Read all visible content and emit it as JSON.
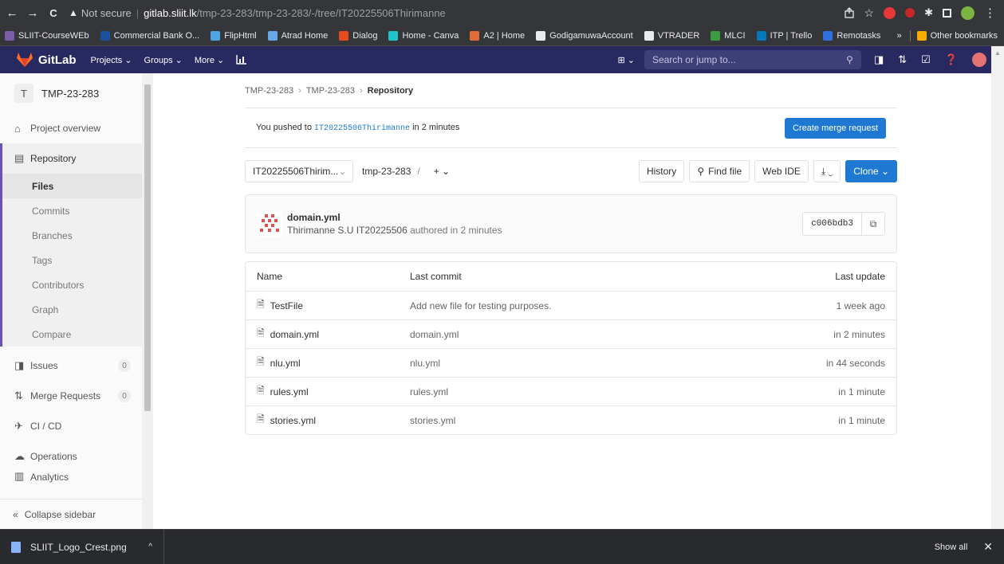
{
  "browser": {
    "nav": {
      "back": "←",
      "forward": "→",
      "reload": "C"
    },
    "url": {
      "warn_icon": "▲",
      "not_secure": "Not secure",
      "separator": "|",
      "host": "gitlab.sliit.lk",
      "path": "/tmp-23-283/tmp-23-283/-/tree/IT20225506Thirimanne"
    },
    "menu_icon": "⋮",
    "bookmarks": [
      {
        "label": "SLIIT-CourseWEb",
        "color": "#7b5ea7"
      },
      {
        "label": "Commercial Bank O...",
        "color": "#1d4f9c"
      },
      {
        "label": "FlipHtml",
        "color": "#4fa3e0"
      },
      {
        "label": "Atrad Home",
        "color": "#6aa7e8"
      },
      {
        "label": "Dialog",
        "color": "#e84b1c"
      },
      {
        "label": "Home - Canva",
        "color": "#20c4cb"
      },
      {
        "label": "A2 | Home",
        "color": "#e06c3a"
      },
      {
        "label": "GodigamuwaAccount",
        "color": "#e8eaed"
      },
      {
        "label": "VTRADER",
        "color": "#e8eaed"
      },
      {
        "label": "MLCI",
        "color": "#3a9c3f"
      },
      {
        "label": "ITP | Trello",
        "color": "#0079bf"
      },
      {
        "label": "Remotasks",
        "color": "#2f6fe0"
      }
    ],
    "more_bookmarks": "»",
    "other_bookmarks": "Other bookmarks"
  },
  "gitlab": {
    "brand": "GitLab",
    "menus": [
      "Projects ⌄",
      "Groups ⌄",
      "More ⌄"
    ],
    "plus_menu": "⊞ ⌄",
    "search_placeholder": "Search or jump to...",
    "search_icon": "⚲"
  },
  "sidebar": {
    "project_initial": "T",
    "project_name": "TMP-23-283",
    "overview": "Project overview",
    "repository": "Repository",
    "sub_items": [
      "Files",
      "Commits",
      "Branches",
      "Tags",
      "Contributors",
      "Graph",
      "Compare"
    ],
    "issues": "Issues",
    "issues_count": "0",
    "merge_requests": "Merge Requests",
    "mr_count": "0",
    "cicd": "CI / CD",
    "operations": "Operations",
    "analytics": "Analytics",
    "collapse": "Collapse sidebar"
  },
  "breadcrumb": {
    "a": "TMP-23-283",
    "b": "TMP-23-283",
    "current": "Repository",
    "sep": "›"
  },
  "push": {
    "prefix": "You pushed to",
    "branch": "IT20225506Thirimanne",
    "suffix": "in 2 minutes",
    "button": "Create merge request"
  },
  "tree": {
    "branch": "IT20225506Thirim...",
    "branch_caret": "⌄",
    "path": "tmp-23-283",
    "slash": "/",
    "add": "+ ⌄",
    "history": "History",
    "find_file": "Find file",
    "web_ide": "Web IDE",
    "download": "⤓ ⌄",
    "clone": "Clone ⌄"
  },
  "commit": {
    "title": "domain.yml",
    "author": "Thirimanne S.U IT20225506",
    "authored": "authored in 2 minutes",
    "sha": "c006bdb3"
  },
  "files": {
    "headers": {
      "name": "Name",
      "last_commit": "Last commit",
      "last_update": "Last update"
    },
    "rows": [
      {
        "name": "TestFile",
        "commit": "Add new file for testing purposes.",
        "updated": "1 week ago"
      },
      {
        "name": "domain.yml",
        "commit": "domain.yml",
        "updated": "in 2 minutes"
      },
      {
        "name": "nlu.yml",
        "commit": "nlu.yml",
        "updated": "in 44 seconds"
      },
      {
        "name": "rules.yml",
        "commit": "rules.yml",
        "updated": "in 1 minute"
      },
      {
        "name": "stories.yml",
        "commit": "stories.yml",
        "updated": "in 1 minute"
      }
    ]
  },
  "downloads": {
    "file": "SLIIT_Logo_Crest.png",
    "caret": "^",
    "show_all": "Show all",
    "close": "✕"
  }
}
